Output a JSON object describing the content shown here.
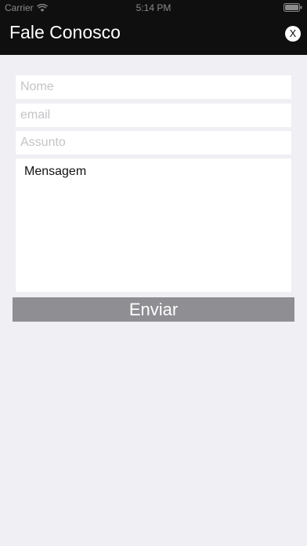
{
  "status_bar": {
    "carrier": "Carrier",
    "time": "5:14 PM"
  },
  "header": {
    "title": "Fale Conosco",
    "close_label": "X"
  },
  "form": {
    "nome_placeholder": "Nome",
    "email_placeholder": "email",
    "assunto_placeholder": "Assunto",
    "mensagem_value": "Mensagem",
    "send_label": "Enviar"
  },
  "colors": {
    "header_bg": "#0f0f0f",
    "page_bg": "#efeff4",
    "button_bg": "#8e8e93"
  }
}
